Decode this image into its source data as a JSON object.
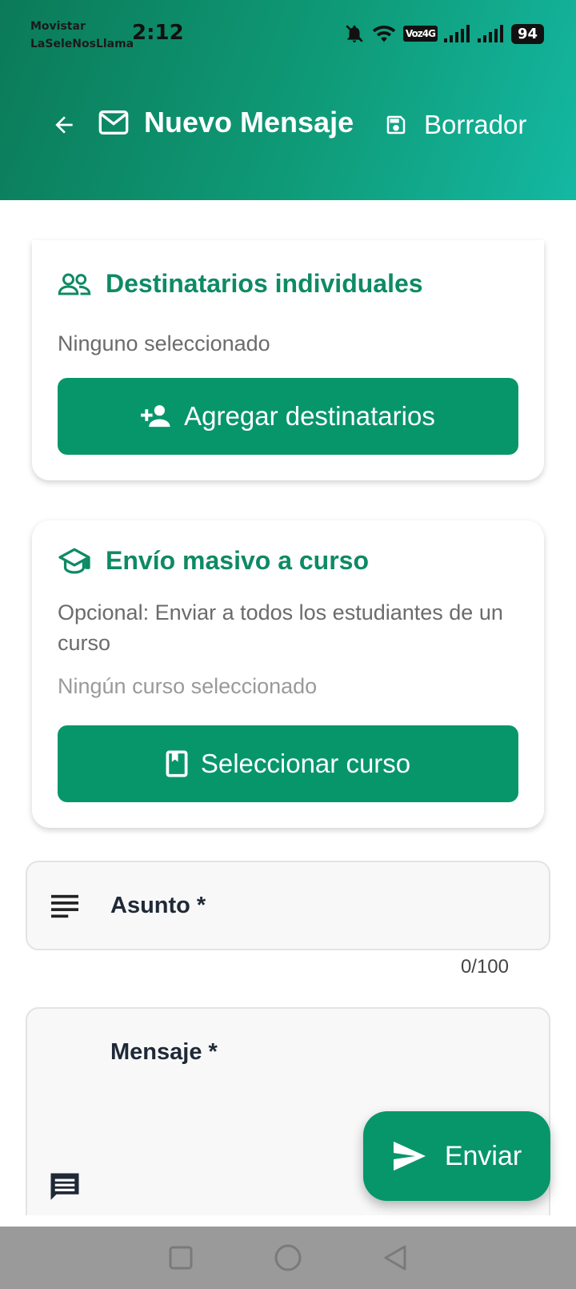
{
  "status_bar": {
    "carrier_line1": "Movistar",
    "carrier_line2": "LaSeleNosLlama",
    "time": "2:12",
    "network_badge": "Voz4G",
    "battery": "94"
  },
  "toolbar": {
    "title": "Nuevo Mensaje",
    "draft_label": "Borrador"
  },
  "individual_recipients": {
    "title": "Destinatarios individuales",
    "status": "Ninguno seleccionado",
    "button_label": "Agregar destinatarios"
  },
  "course_broadcast": {
    "title": "Envío masivo a curso",
    "description": "Opcional: Enviar a todos los estudiantes de un curso",
    "status": "Ningún curso seleccionado",
    "button_label": "Seleccionar curso"
  },
  "subject_field": {
    "label": "Asunto *",
    "counter": "0/100"
  },
  "message_field": {
    "label": "Mensaje *"
  },
  "fab": {
    "label": "Enviar"
  },
  "colors": {
    "primary": "#07966a",
    "title_green": "#0e8a64",
    "header_gradient_start": "#0b7a58",
    "header_gradient_end": "#14b8a2"
  },
  "icons": [
    "back-arrow-icon",
    "mail-icon",
    "save-icon",
    "people-icon",
    "add-person-icon",
    "school-icon",
    "book-icon",
    "subject-lines-icon",
    "message-icon",
    "send-icon"
  ]
}
